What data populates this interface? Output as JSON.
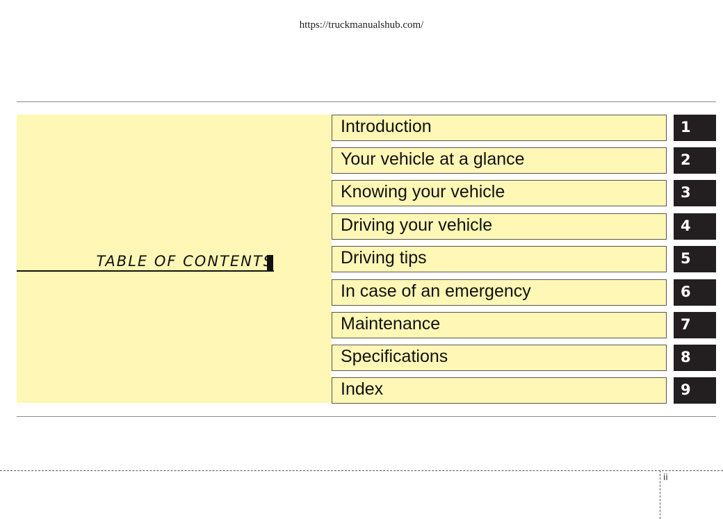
{
  "header": {
    "url": "https://truckmanualshub.com/"
  },
  "toc": {
    "heading": "TABLE OF CONTENTS",
    "items": [
      {
        "label": "Introduction",
        "number": "1"
      },
      {
        "label": "Your vehicle at a glance",
        "number": "2"
      },
      {
        "label": "Knowing your vehicle",
        "number": "3"
      },
      {
        "label": "Driving your vehicle",
        "number": "4"
      },
      {
        "label": "Driving tips",
        "number": "5"
      },
      {
        "label": "In case of an emergency",
        "number": "6"
      },
      {
        "label": "Maintenance",
        "number": "7"
      },
      {
        "label": "Specifications",
        "number": "8"
      },
      {
        "label": "Index",
        "number": "9"
      }
    ]
  },
  "footer": {
    "page_number": "ii"
  },
  "colors": {
    "panel_fill": "#fff7b5",
    "number_tab": "#231f20",
    "text": "#111111"
  }
}
